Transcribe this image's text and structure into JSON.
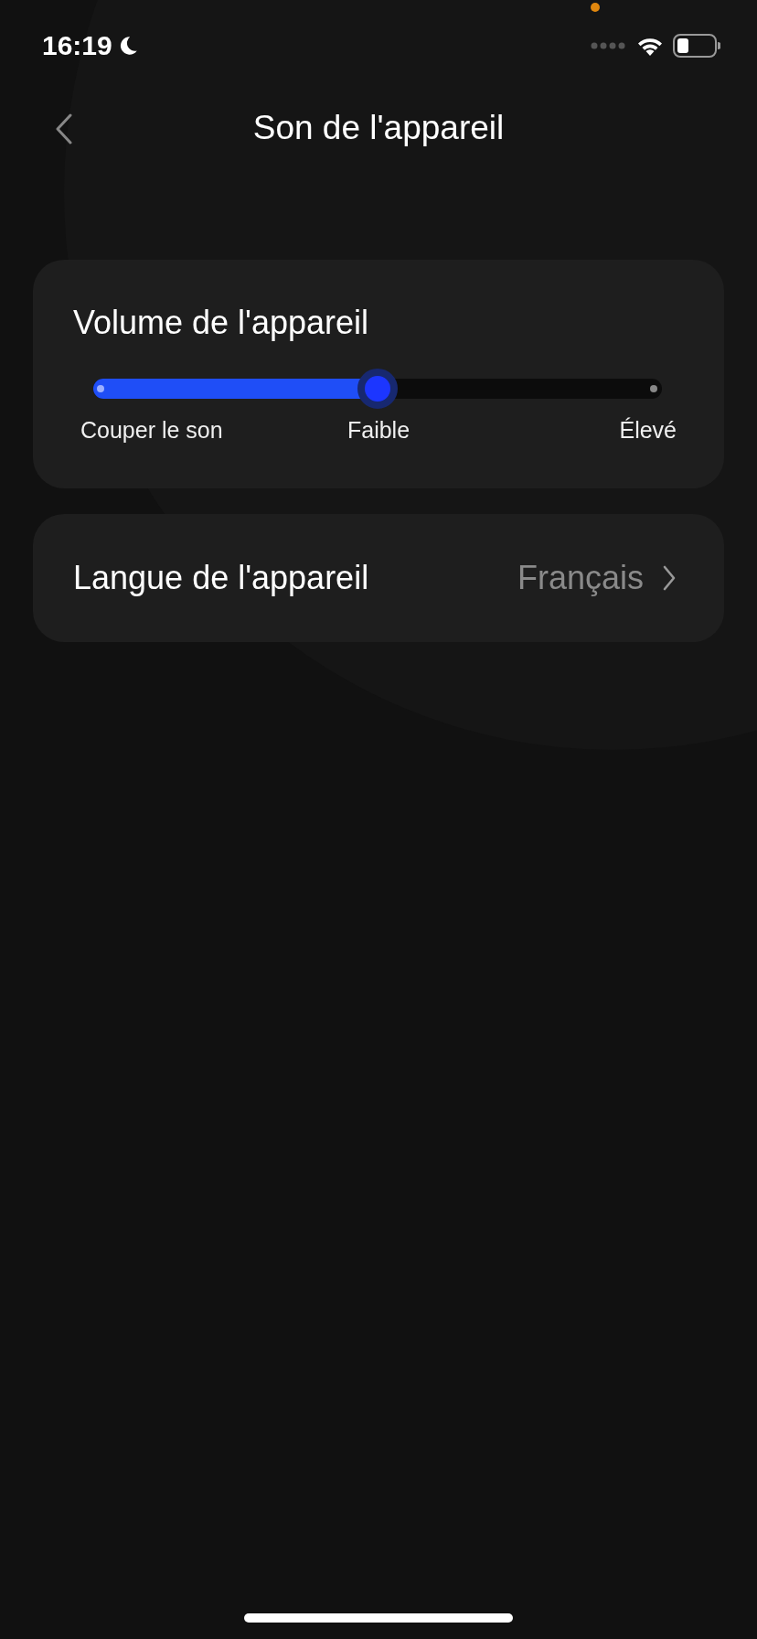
{
  "status_bar": {
    "time": "16:19"
  },
  "header": {
    "title": "Son de l'appareil"
  },
  "volume": {
    "title": "Volume de l'appareil",
    "level": 0.5,
    "labels": [
      "Couper le son",
      "Faible",
      "Élevé"
    ]
  },
  "language": {
    "label": "Langue de l'appareil",
    "value": "Français"
  }
}
